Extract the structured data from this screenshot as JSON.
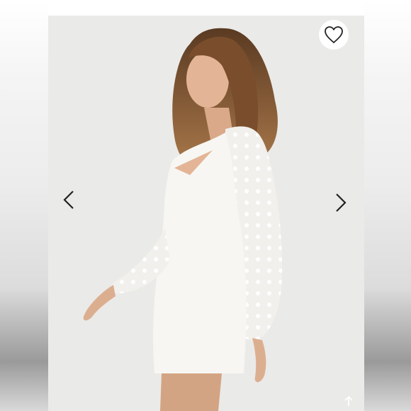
{
  "gallery": {
    "favorite_icon": "heart-outline-icon",
    "prev_icon": "chevron-left-icon",
    "next_icon": "chevron-right-icon",
    "scroll_top_icon": "arrow-up-icon",
    "colors": {
      "background": "#eaeae8",
      "icon": "#222222",
      "dress": "#f7f6f2"
    }
  }
}
